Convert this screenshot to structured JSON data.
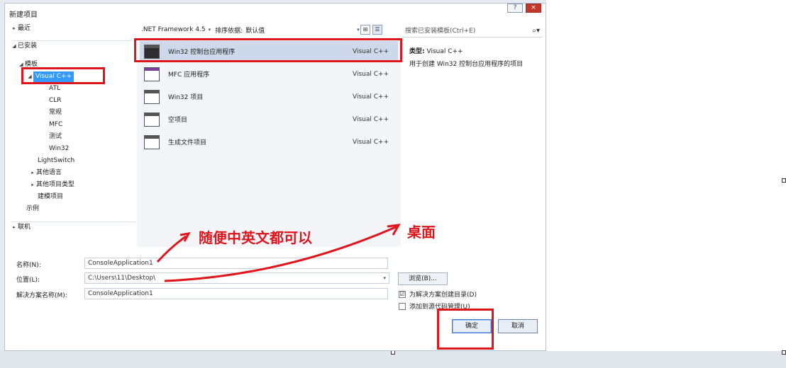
{
  "dialog": {
    "title": "新建项目",
    "window_buttons": [
      "?",
      "×"
    ]
  },
  "tree": {
    "items": [
      {
        "label": "最近",
        "arrow": "▸"
      },
      {
        "label": "已安装",
        "arrow": "◢"
      },
      {
        "label": "模板",
        "arrow": "◢"
      },
      {
        "label": "Visual C++",
        "arrow": "◢"
      },
      {
        "label": "ATL",
        "arrow": ""
      },
      {
        "label": "CLR",
        "arrow": ""
      },
      {
        "label": "常规",
        "arrow": ""
      },
      {
        "label": "MFC",
        "arrow": ""
      },
      {
        "label": "测试",
        "arrow": ""
      },
      {
        "label": "Win32",
        "arrow": ""
      },
      {
        "label": "LightSwitch",
        "arrow": ""
      },
      {
        "label": "其他语言",
        "arrow": "▸"
      },
      {
        "label": "其他项目类型",
        "arrow": "▸"
      },
      {
        "label": "建模项目",
        "arrow": ""
      },
      {
        "label": "示例",
        "arrow": ""
      },
      {
        "label": "联机",
        "arrow": "▸"
      }
    ]
  },
  "filter": {
    "framework": ".NET Framework 4.5",
    "sort_label": "排序依据:",
    "sort_value": "默认值",
    "view_buttons": [
      "⊞",
      "☰"
    ]
  },
  "templates": [
    {
      "name": "Win32 控制台应用程序",
      "lang": "Visual C++"
    },
    {
      "name": "MFC 应用程序",
      "lang": "Visual C++"
    },
    {
      "name": "Win32 项目",
      "lang": "Visual C++"
    },
    {
      "name": "空项目",
      "lang": "Visual C++"
    },
    {
      "name": "生成文件项目",
      "lang": "Visual C++"
    }
  ],
  "search": {
    "placeholder": "搜索已安装模板(Ctrl+E)",
    "icon": "search-icon"
  },
  "description": {
    "type_label": "类型:",
    "type_value": "Visual C++",
    "text": "用于创建 Win32 控制台应用程序的项目"
  },
  "form": {
    "name_label": "名称(N):",
    "name_value": "ConsoleApplication1",
    "location_label": "位置(L):",
    "location_value": "C:\\Users\\11\\Desktop\\",
    "solution_label": "解决方案名称(M):",
    "solution_value": "ConsoleApplication1",
    "browse_label": "浏览(B)...",
    "check_dir_label": "为解决方案创建目录(D)",
    "check_dir_checked": "☑",
    "check_src_label": "添加到源代码管理(U)"
  },
  "buttons": {
    "ok": "确定",
    "cancel": "取消"
  },
  "annotations": {
    "name_hint": "随便中英文都可以",
    "location_hint": "桌面"
  },
  "colors": {
    "annotation": "#e0141b",
    "selection": "#3399ff"
  }
}
